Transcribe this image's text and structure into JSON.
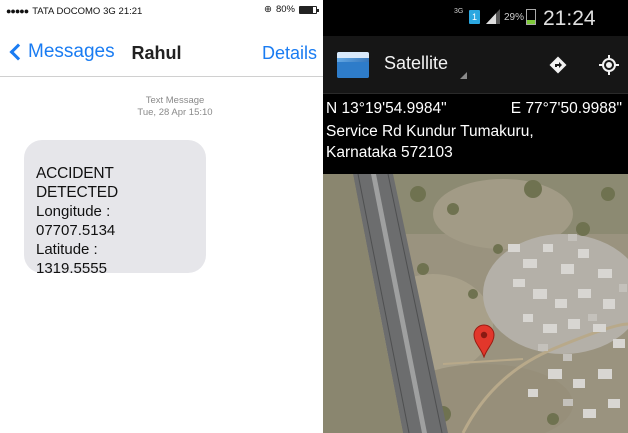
{
  "ios": {
    "status": {
      "signal_dots": "●●●●●",
      "carrier": "TATA DOCOMO",
      "network": "3G",
      "time": "21:21",
      "battery": "80%",
      "battery_level": 0.8
    },
    "nav": {
      "back_label": "Messages",
      "title": "Rahul",
      "details_label": "Details"
    },
    "message": {
      "type_label": "Text Message",
      "timestamp": "Tue, 28 Apr 15:10",
      "lines": [
        "ACCIDENT DETECTED",
        "Longitude :",
        "07707.5134",
        "Latitude :",
        "1319.5555"
      ]
    }
  },
  "android": {
    "status": {
      "network": "3G",
      "sim": "1",
      "battery": "29%",
      "battery_level": 0.29,
      "time": "21:24"
    },
    "toolbar": {
      "app_icon": "satellite-map-icon",
      "title": "Satellite",
      "actions": [
        "navigation-icon",
        "my-location-icon"
      ]
    },
    "location": {
      "latitude": "N 13°19'54.9984\"",
      "longitude": "E 77°7'50.9988\"",
      "address_line1": "Service Rd Kundur Tumakuru,",
      "address_line2": "Karnataka 572103"
    },
    "map": {
      "marker": "map-pin-icon",
      "marker_color": "#e2372b"
    }
  }
}
